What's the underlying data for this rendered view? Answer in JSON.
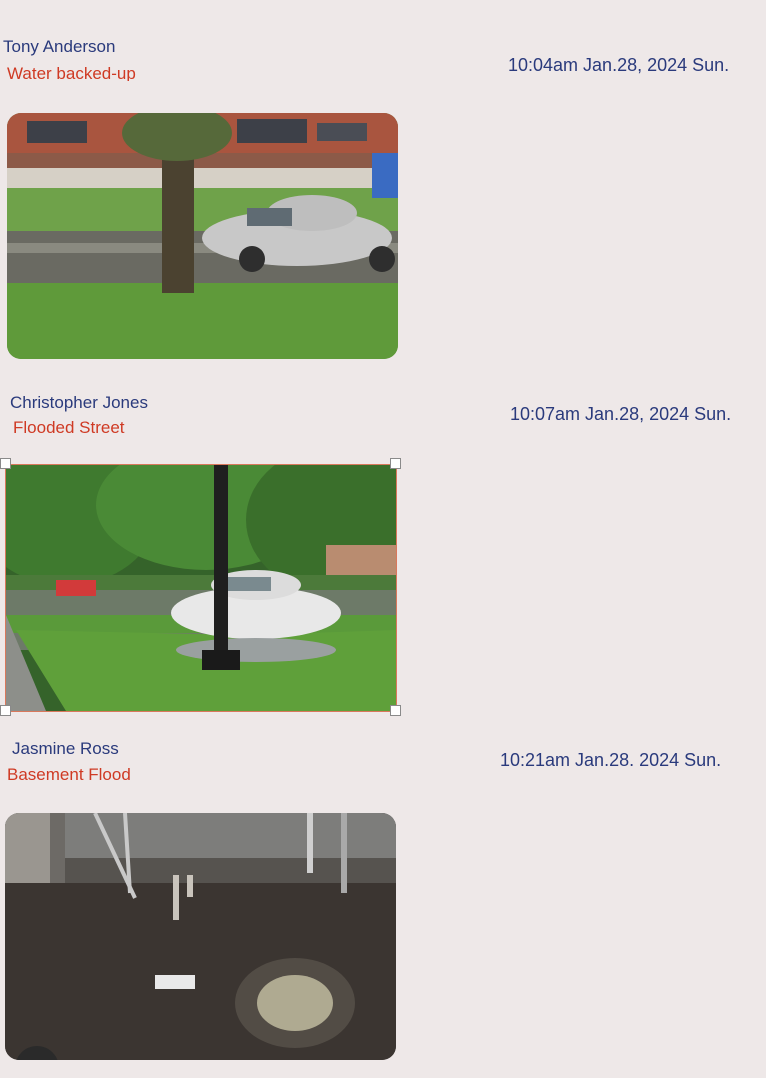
{
  "reports": [
    {
      "name": "Tony Anderson",
      "category": "Water backed-up",
      "time": "10:04am Jan.28, 2024 Sun.",
      "photo": "flooded-street-car-tree-photo"
    },
    {
      "name": "Christopher Jones",
      "category": "Flooded Street",
      "time": "10:07am Jan.28, 2024 Sun.",
      "photo": "flooded-street-car-lamppost-photo"
    },
    {
      "name": "Jasmine Ross",
      "category": "Basement Flood",
      "time": "10:21am Jan.28. 2024 Sun.",
      "photo": "flooded-basement-photo"
    }
  ],
  "colors": {
    "background": "#eee8e8",
    "name": "#2a3a7c",
    "category": "#cf3a24",
    "selection": "#d9785c"
  }
}
